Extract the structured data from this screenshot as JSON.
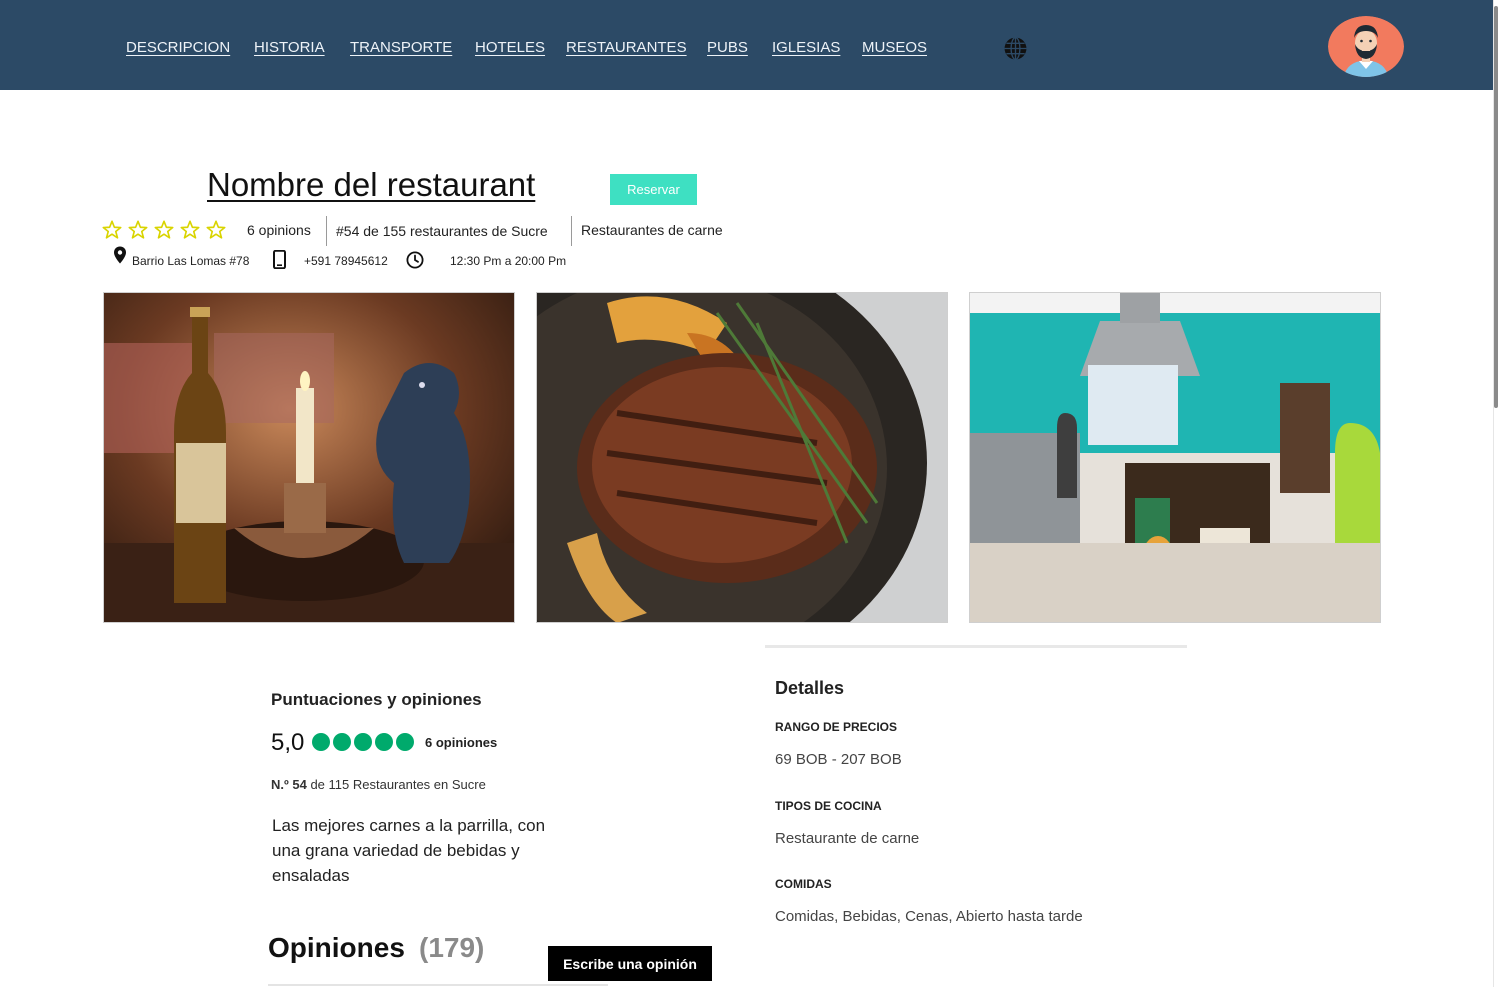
{
  "nav": {
    "links": [
      "DESCRIPCION",
      "HISTORIA",
      "TRANSPORTE",
      "HOTELES",
      "RESTAURANTES",
      "PUBS",
      "IGLESIAS",
      "MUSEOS"
    ],
    "globe_icon": "globe-icon",
    "avatar_icon": "user-avatar-icon"
  },
  "header": {
    "title": "Nombre del restaurant",
    "reserve_label": "Reservar",
    "rating_stars": 5,
    "opinions": "6 opinions",
    "ranking": "#54 de 155 restaurantes de Sucre",
    "category": "Restaurantes de carne",
    "address": "Barrio Las Lomas #78",
    "phone": "+591 78945612",
    "hours": "12:30 Pm a 20:00 Pm"
  },
  "photos": [
    "bar-table-photo",
    "grilled-steak-photo",
    "kitchen-photo"
  ],
  "ratings": {
    "title": "Puntuaciones y opiniones",
    "score": "5,0",
    "bubbles": 5,
    "opinions": "6 opiniones",
    "rank_prefix": "N.º 54",
    "rank_suffix": "de 115 Restaurantes en Sucre",
    "description": "Las mejores carnes a la parrilla, con una grana variedad de bebidas y ensaladas"
  },
  "reviews": {
    "title": "Opiniones",
    "count": "(179)",
    "write_label": "Escribe una opinión"
  },
  "details": {
    "title": "Detalles",
    "price_label": "RANGO DE PRECIOS",
    "price_value": "69 BOB - 207 BOB",
    "cuisine_label": "TIPOS DE COCINA",
    "cuisine_value": "Restaurante de carne",
    "meals_label": "COMIDAS",
    "meals_value": "Comidas, Bebidas, Cenas, Abierto hasta tarde"
  },
  "colors": {
    "nav_bg": "#2c4a66",
    "reserve_btn": "#3ee0c2",
    "rating_green": "#00aa6c",
    "star_yellow": "#e2e000"
  }
}
